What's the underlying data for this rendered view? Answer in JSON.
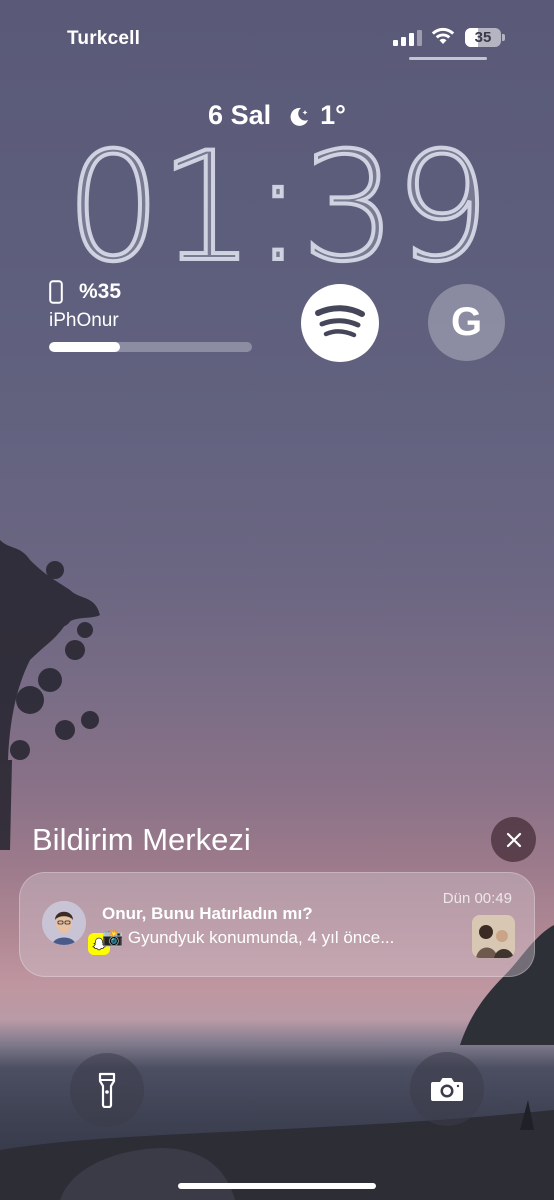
{
  "status_bar": {
    "carrier": "Turkcell",
    "battery_level": "35",
    "battery_fraction": 0.35,
    "signal_bars": 3,
    "icons": [
      "signal-icon",
      "wifi-icon",
      "battery-icon"
    ]
  },
  "lock": {
    "date": "6 Sal",
    "weather_temp": "1°",
    "weather_icon": "moon-star-icon",
    "time": "01:39"
  },
  "widgets": {
    "battery": {
      "percent_label": "%35",
      "device_name": "iPhOnur",
      "level": 0.35,
      "icon": "phone-icon"
    },
    "apps": [
      {
        "name": "spotify",
        "icon": "spotify-icon"
      },
      {
        "name": "google",
        "icon": "google-icon",
        "glyph": "G"
      }
    ]
  },
  "notification_center": {
    "title": "Bildirim Merkezi",
    "close_icon": "close-icon",
    "notifications": [
      {
        "app_icon": "snapchat-icon",
        "title": "Onur, Bunu Hatırladın mı?",
        "body": "📸 Gyundyuk konumunda, 4 yıl önce...",
        "time": "Dün 00:49"
      }
    ]
  },
  "bottom": {
    "left_icon": "flashlight-icon",
    "right_icon": "camera-icon"
  },
  "colors": {
    "sky_top": "#5a5a78",
    "sky_horizon": "#bf96a0",
    "sea": "#3e4253"
  }
}
